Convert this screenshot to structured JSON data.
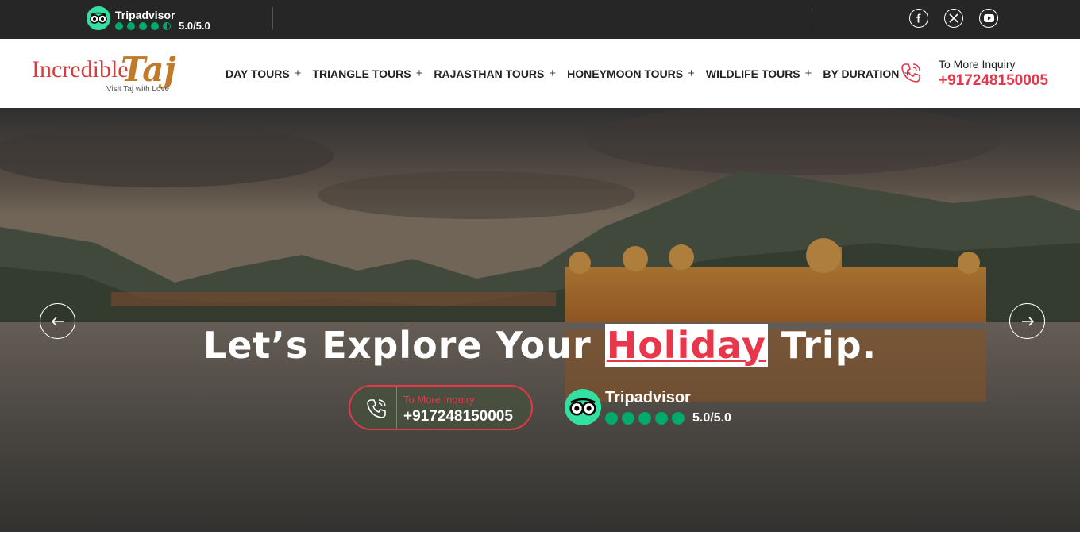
{
  "topbar": {
    "tripadvisor_name": "Tripadvisor",
    "rating": "5.0/5.0",
    "socials": [
      "facebook-icon",
      "x-icon",
      "youtube-icon"
    ]
  },
  "header": {
    "logo": {
      "brand": "Incredible",
      "brand_accent": "Taj",
      "tagline": "Visit Taj with Love"
    },
    "nav": [
      {
        "label": "DAY TOURS"
      },
      {
        "label": "TRIANGLE TOURS"
      },
      {
        "label": "RAJASTHAN TOURS"
      },
      {
        "label": "HONEYMOON TOURS"
      },
      {
        "label": "WILDLIFE TOURS"
      },
      {
        "label": "BY DURATION"
      }
    ],
    "inquiry_label": "To More Inquiry",
    "inquiry_phone": "+917248150005"
  },
  "hero": {
    "title_before": "Let’s Explore Your ",
    "title_highlight": "Holiday",
    "title_after": " Trip.",
    "inquiry_label": "To More Inquiry",
    "inquiry_phone": "+917248150005",
    "tripadvisor_name": "Tripadvisor",
    "rating": "5.0/5.0"
  },
  "colors": {
    "accent": "#e8364a",
    "topbar": "#262626",
    "tripadvisor_green": "#34e0a1",
    "rating_dot": "#00aa6c"
  }
}
